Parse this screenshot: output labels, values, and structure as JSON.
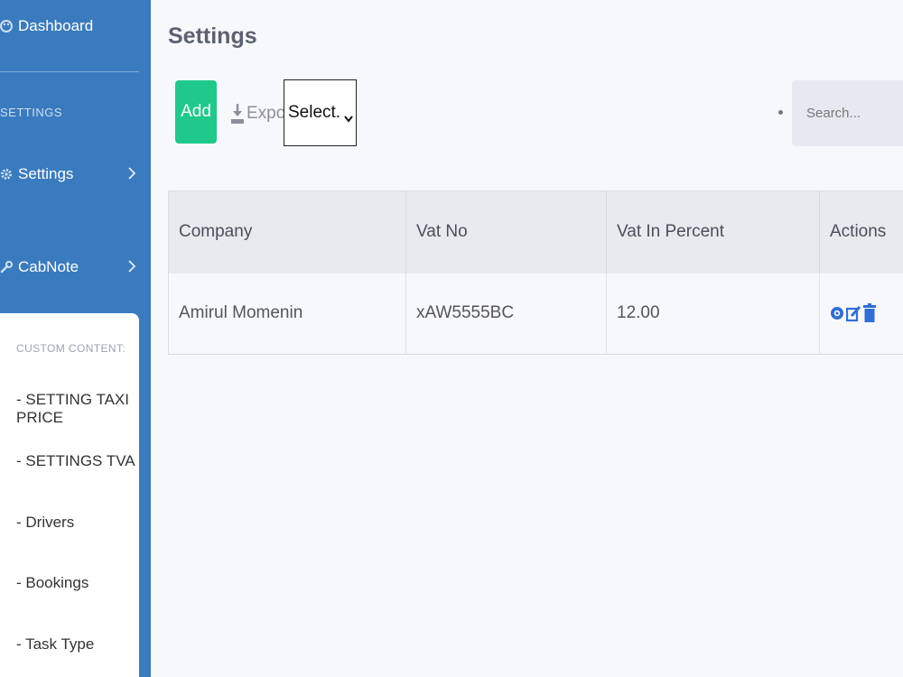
{
  "sidebar": {
    "dashboard_label": "Dashboard",
    "section_label": "SETTINGS",
    "settings_label": "Settings",
    "cabnote_label": "CabNote",
    "submenu": {
      "title": "CUSTOM CONTENT:",
      "items": [
        {
          "label": "- SETTING TAXI PRICE"
        },
        {
          "label": "- SETTINGS TVA"
        },
        {
          "label": "- Drivers"
        },
        {
          "label": "- Bookings"
        },
        {
          "label": "- Task Type"
        }
      ]
    }
  },
  "page": {
    "title": "Settings"
  },
  "toolbar": {
    "add_label": "Add",
    "export_label": "Export",
    "select_value": "Select.",
    "search_placeholder": "Search..."
  },
  "table": {
    "headers": {
      "company": "Company",
      "vat_no": "Vat No",
      "vat_percent": "Vat In Percent",
      "actions": "Actions"
    },
    "rows": [
      {
        "company": "Amirul Momenin",
        "vat_no": "xAW5555BC",
        "vat_percent": "12.00"
      }
    ]
  },
  "colors": {
    "sidebar": "#3a7bbf",
    "add_button": "#1fc989",
    "action_icons": "#2f6fd6"
  },
  "icons": {
    "dashboard": "palette-icon",
    "settings": "gear-icon",
    "cabnote": "wrench-icon",
    "export": "download-icon",
    "view": "eye-icon",
    "edit": "edit-icon",
    "delete": "trash-icon"
  }
}
